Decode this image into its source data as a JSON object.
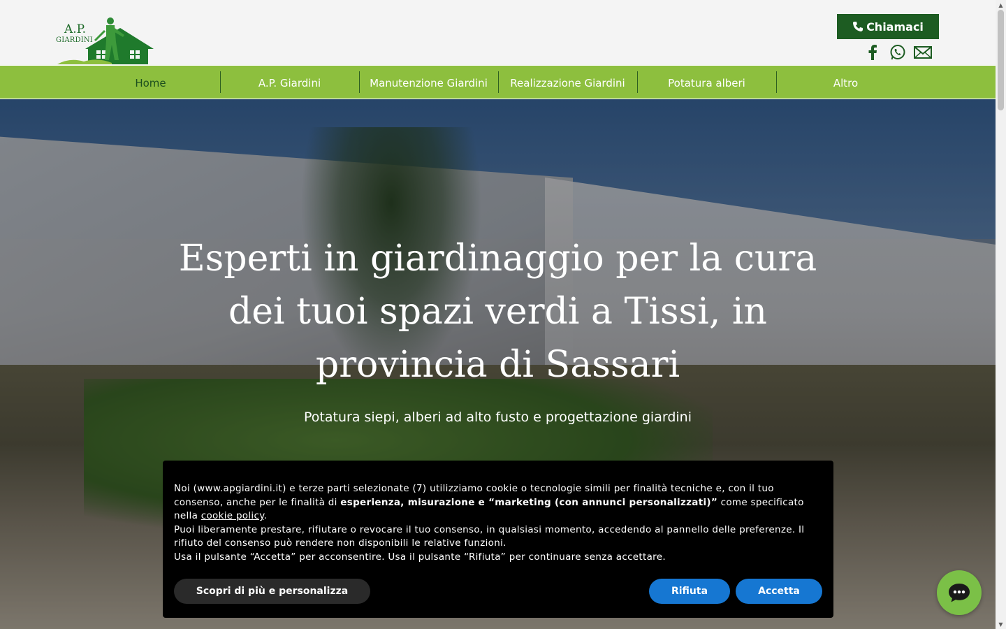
{
  "header": {
    "logo": {
      "line1": "A.P.",
      "line2": "GIARDINI"
    },
    "call_button": "Chiamaci",
    "social": [
      "facebook-icon",
      "whatsapp-icon",
      "mail-icon"
    ]
  },
  "nav": {
    "items": [
      {
        "label": "Home",
        "active": true
      },
      {
        "label": "A.P. Giardini",
        "active": false
      },
      {
        "label": "Manutenzione Giardini",
        "active": false
      },
      {
        "label": "Realizzazione Giardini",
        "active": false
      },
      {
        "label": "Potatura alberi",
        "active": false
      },
      {
        "label": "Altro",
        "active": false
      }
    ]
  },
  "hero": {
    "title": "Esperti in giardinaggio per la cura dei tuoi spazi verdi a Tissi, in provincia di Sassari",
    "subtitle": "Potatura siepi, alberi ad alto fusto e progettazione giardini"
  },
  "cookie": {
    "p1_a": "Noi (www.apgiardini.it) e terze parti selezionate (7) utilizziamo cookie o tecnologie simili per finalità tecniche e, con il tuo consenso, anche per le finalità di ",
    "p1_bold": "esperienza, misurazione e “marketing (con annunci personalizzati)”",
    "p1_b": " come specificato nella ",
    "p1_link": "cookie policy",
    "p1_end": ".",
    "p2": "Puoi liberamente prestare, rifiutare o revocare il tuo consenso, in qualsiasi momento, accedendo al pannello delle preferenze. Il rifiuto del consenso può rendere non disponibili le relative funzioni.",
    "p3": "Usa il pulsante “Accetta” per acconsentire. Usa il pulsante “Rifiuta” per continuare senza accettare.",
    "btn_more": "Scopri di più e personalizza",
    "btn_reject": "Rifiuta",
    "btn_accept": "Accetta"
  },
  "colors": {
    "brand_dark": "#1d5c22",
    "nav_green": "#8dbf3e",
    "cookie_button": "#1677d2",
    "chat_green": "#7bc047"
  }
}
